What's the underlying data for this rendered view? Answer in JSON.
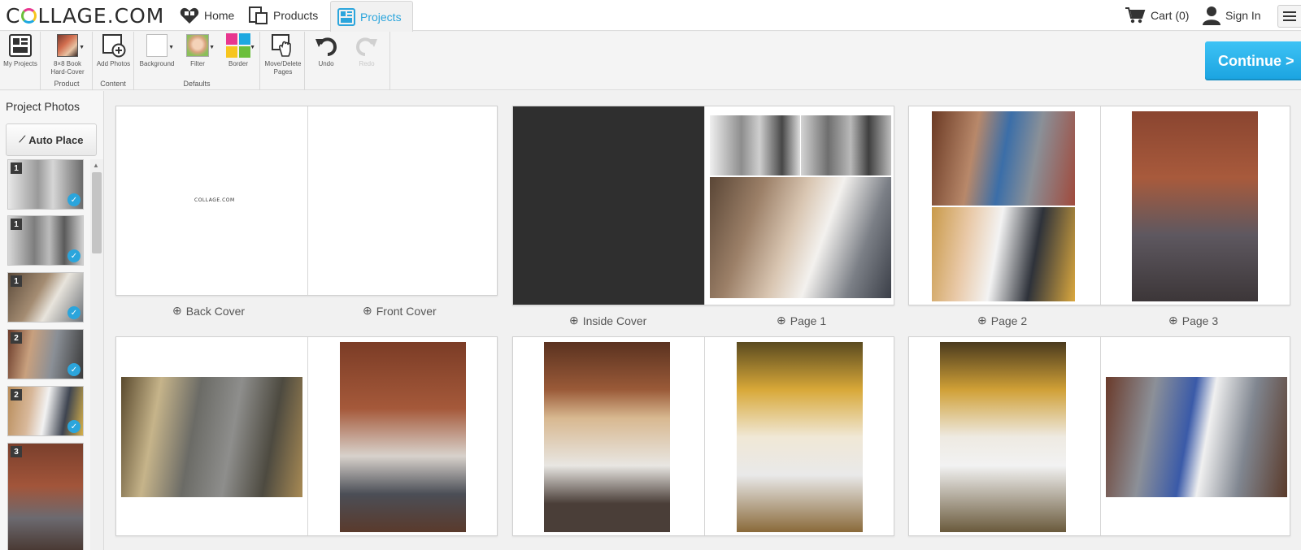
{
  "brand": {
    "logo_text_pre": "C",
    "logo_text_post": "LLAGE.COM"
  },
  "nav": {
    "home": "Home",
    "products": "Products",
    "projects": "Projects",
    "cart": "Cart (0)",
    "signin": "Sign In"
  },
  "toolbar": {
    "my_projects": "My Projects",
    "product_line1": "8×8 Book",
    "product_line2": "Hard-Cover",
    "product_group": "Product",
    "add_photos": "Add Photos",
    "content_group": "Content",
    "background": "Background",
    "filter": "Filter",
    "border": "Border",
    "defaults_group": "Defaults",
    "move_delete_line1": "Move/Delete",
    "move_delete_line2": "Pages",
    "undo": "Undo",
    "redo": "Redo",
    "continue": "Continue >"
  },
  "sidebar": {
    "title": "Project Photos",
    "auto_place": "Auto Place",
    "thumbs": [
      {
        "num": "1",
        "checked": true
      },
      {
        "num": "1",
        "checked": true
      },
      {
        "num": "1",
        "checked": true
      },
      {
        "num": "2",
        "checked": true
      },
      {
        "num": "2",
        "checked": true
      },
      {
        "num": "3",
        "checked": false
      }
    ]
  },
  "pages": {
    "back_cover": "Back Cover",
    "front_cover": "Front Cover",
    "inside_cover": "Inside Cover",
    "page1": "Page 1",
    "page2": "Page 2",
    "page3": "Page 3",
    "cover_logo": "COLLAGE.COM"
  },
  "colors": {
    "accent": "#2ba5dc",
    "continue": "#1aa3e0",
    "inside_cover": "#2f2f2f"
  }
}
